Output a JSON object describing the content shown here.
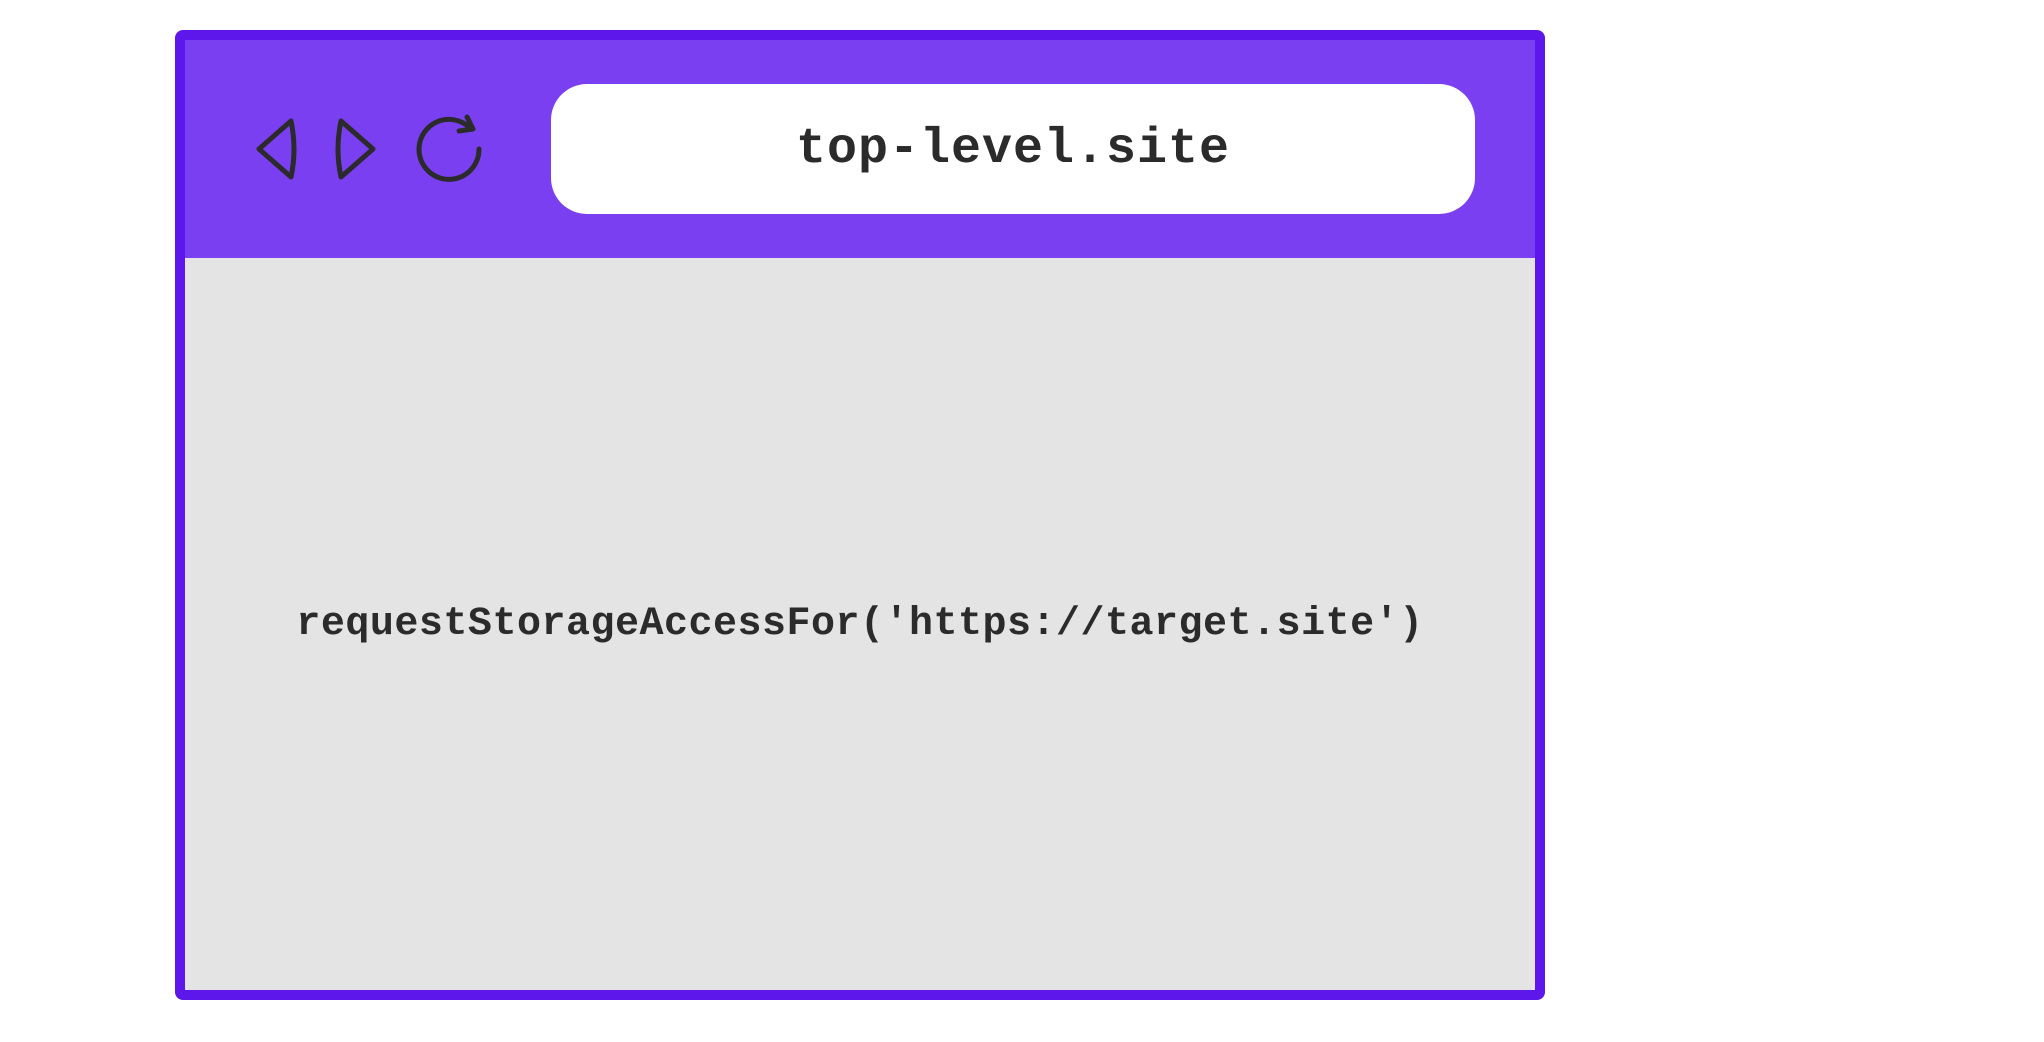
{
  "browser": {
    "address": "top-level.site",
    "content_code": "requestStorageAccessFor('https://target.site')"
  }
}
